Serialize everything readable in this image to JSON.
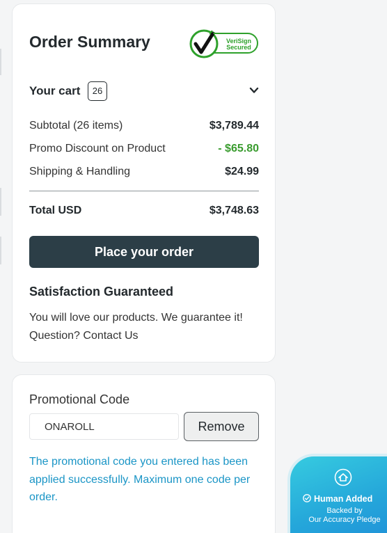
{
  "order_summary": {
    "title": "Order Summary",
    "verisign": {
      "line1": "VeriSign",
      "line2": "Secured"
    },
    "cart": {
      "label": "Your cart",
      "count": "26"
    },
    "lines": [
      {
        "label": "Subtotal (26 items)",
        "value": "$3,789.44"
      },
      {
        "label": "Promo Discount on Product",
        "value": "- $65.80"
      },
      {
        "label": "Shipping & Handling",
        "value": "$24.99"
      }
    ],
    "total": {
      "label": "Total USD",
      "value": "$3,748.63"
    },
    "place_order_label": "Place your order",
    "satisfaction": {
      "title": "Satisfaction Guaranteed",
      "line1": "You will love our products. We guarantee it!",
      "line2": "Question? Contact Us"
    }
  },
  "promo": {
    "label": "Promotional Code",
    "code_value": "ONAROLL",
    "remove_label": "Remove",
    "message": "The promotional code you entered has been applied successfully. Maximum one code per order."
  },
  "badge": {
    "title": "Human Added",
    "line1": "Backed by",
    "line2": "Our Accuracy Pledge"
  },
  "colors": {
    "button_dark": "#2c3e47",
    "discount_green": "#3a9c2f",
    "verisign_green": "#2ea12b",
    "message_blue": "#1a95c6",
    "badge_blue": "#25a7da"
  },
  "icons": [
    "verisign-check-icon",
    "chevron-down-icon",
    "house-icon",
    "check-circle-icon"
  ]
}
